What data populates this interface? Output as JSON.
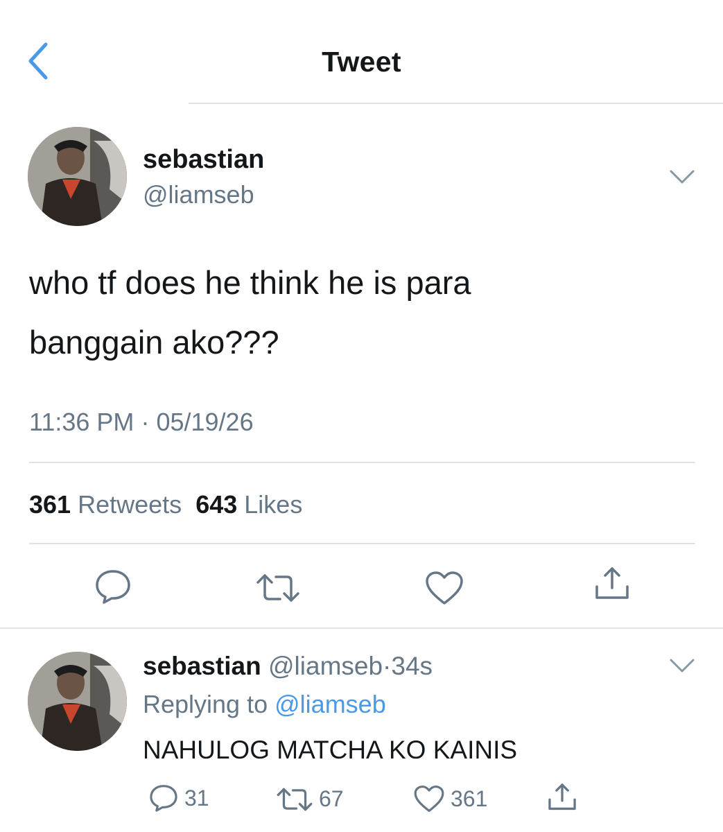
{
  "header": {
    "title": "Tweet",
    "back_icon": "chevron-left-icon"
  },
  "colors": {
    "accent": "#4a99e9",
    "muted": "#657786",
    "text": "#14171a",
    "divider": "#dfe3e6"
  },
  "tweet": {
    "name": "sebastian",
    "handle": "@liamseb",
    "text_line1": "who tf does he think he is para",
    "text_line2": "banggain ako???",
    "time": "11:36 PM",
    "separator": "·",
    "date": "05/19/26",
    "retweets_count": "361",
    "retweets_label": "Retweets",
    "likes_count": "643",
    "likes_label": "Likes"
  },
  "reply": {
    "name": "sebastian",
    "handle": "@liamseb",
    "separator": "·",
    "age": "34s",
    "replying_prefix": "Replying to",
    "replying_handle": "@liamseb",
    "text": "NAHULOG MATCHA KO KAINIS",
    "reply_count": "31",
    "retweet_count": "67",
    "like_count": "361"
  }
}
